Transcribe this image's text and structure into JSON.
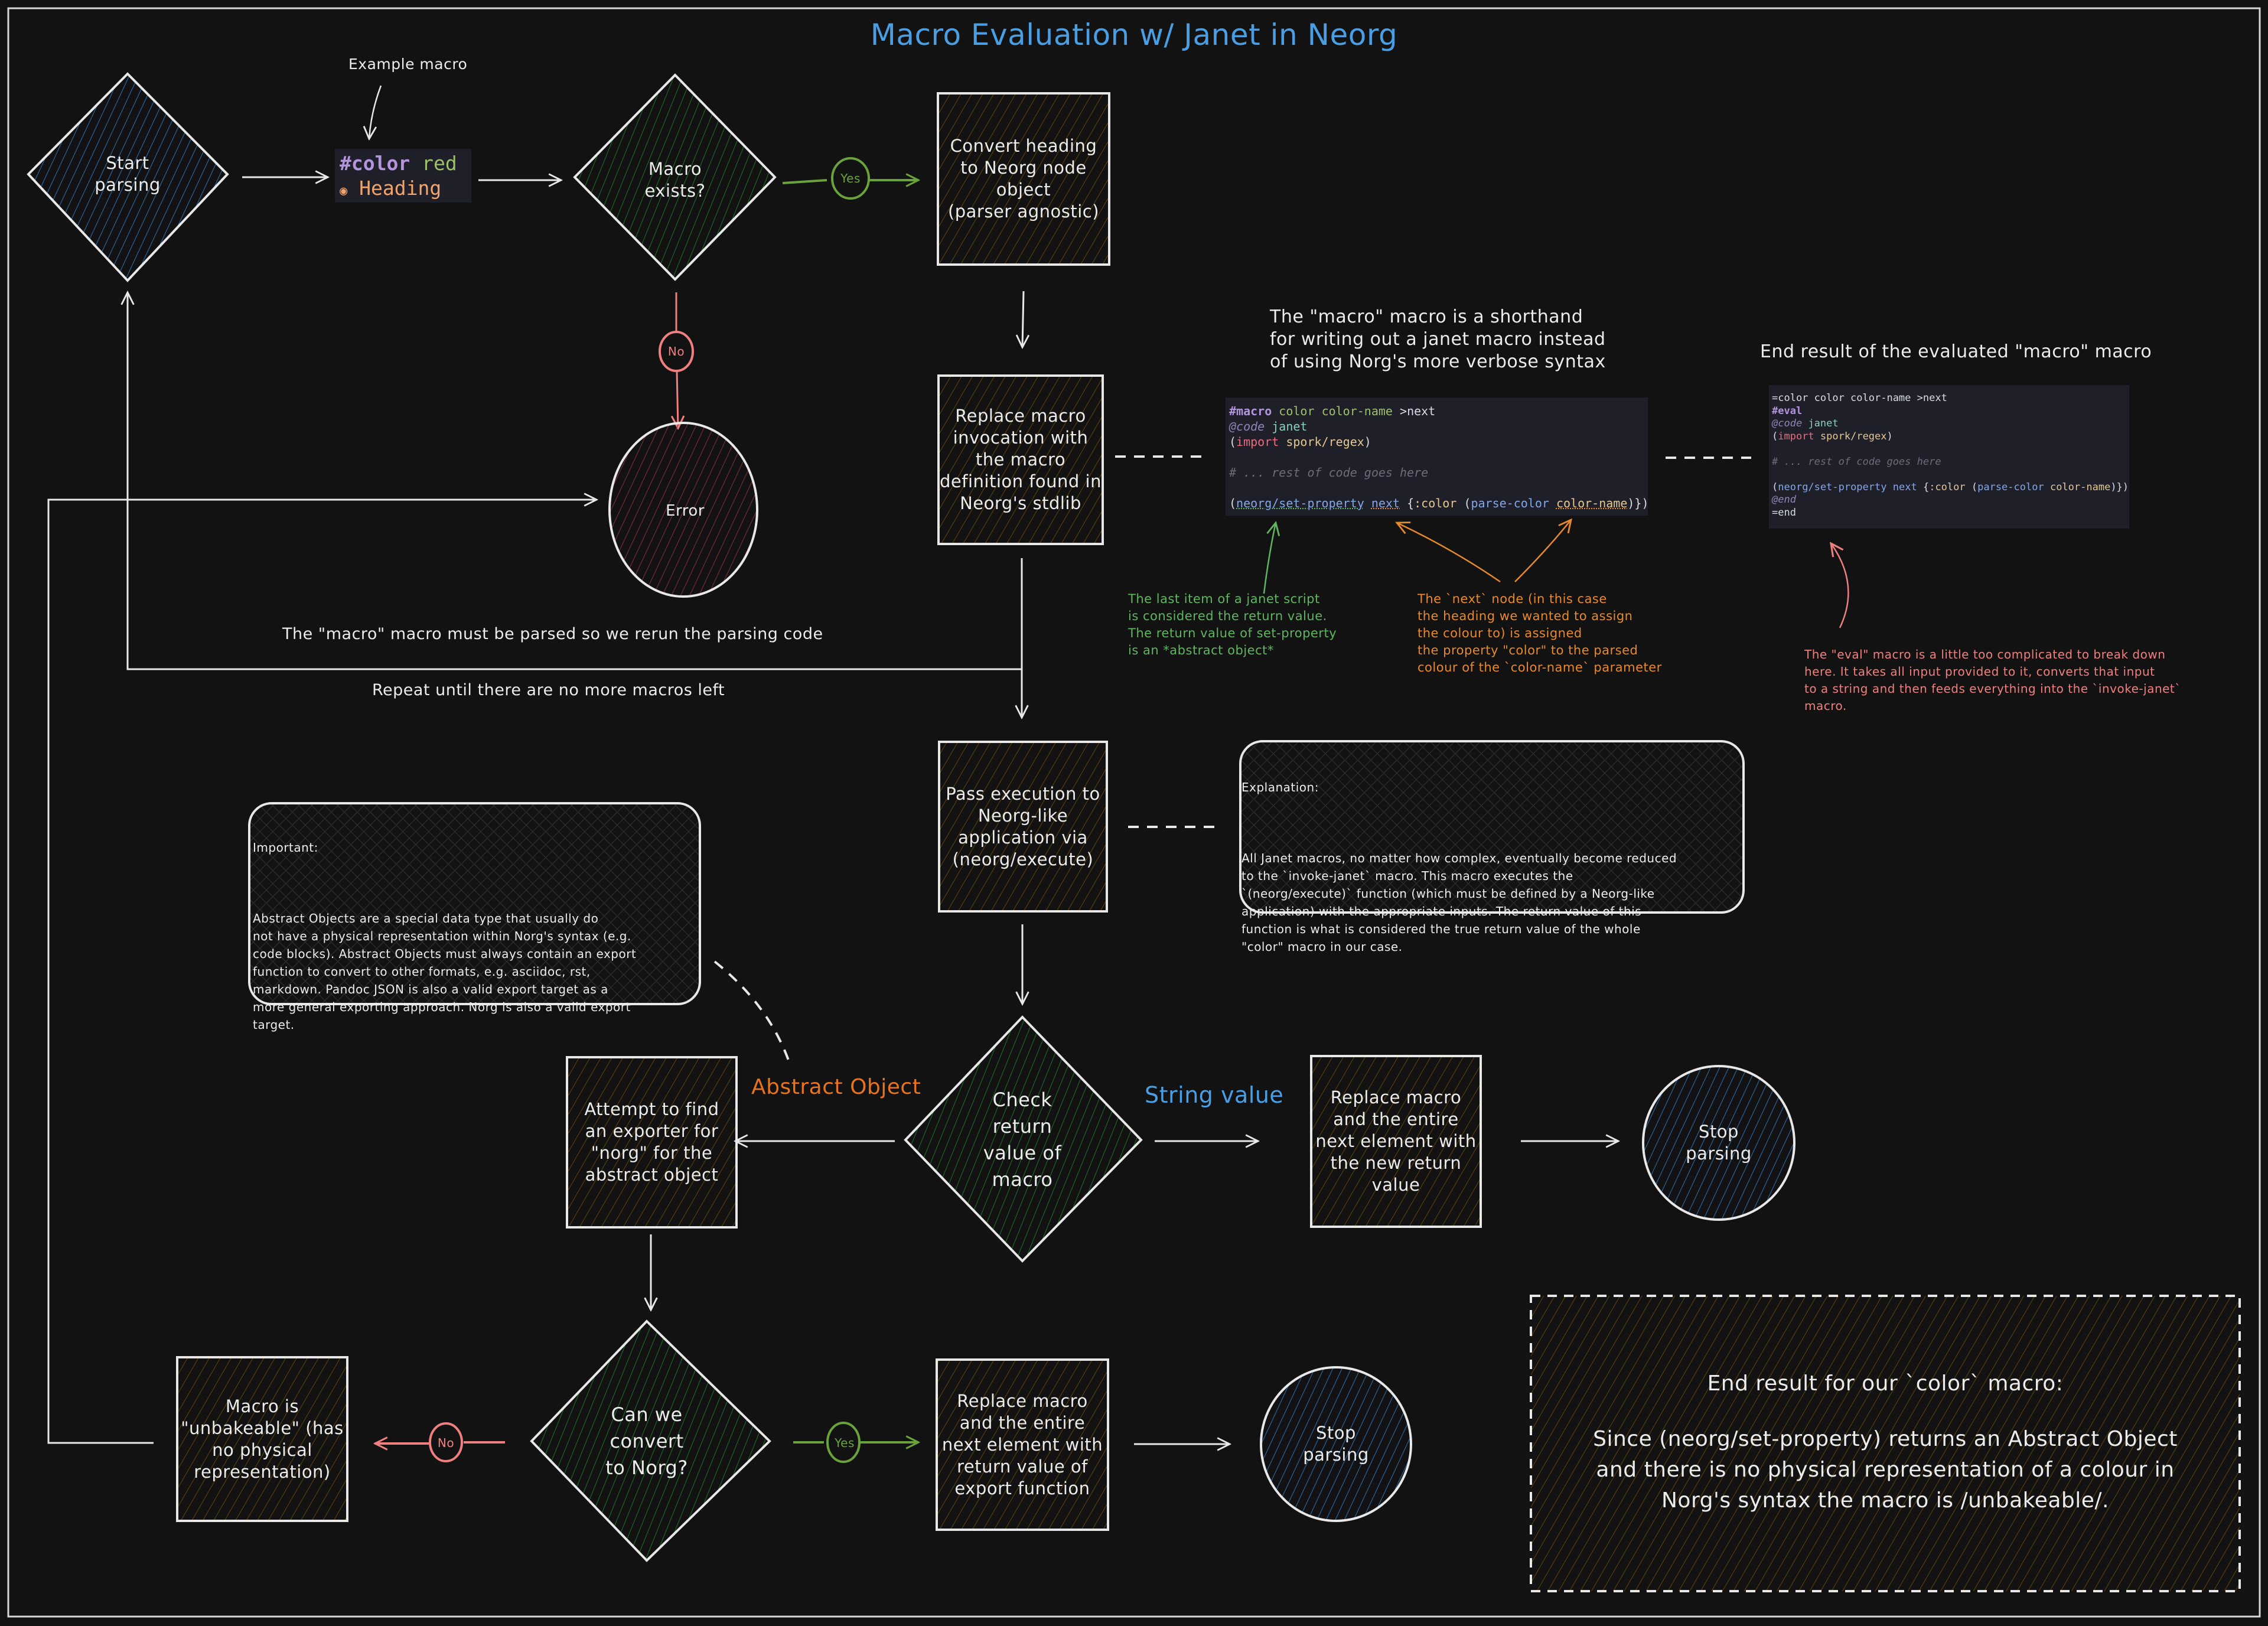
{
  "title": "Macro Evaluation w/ Janet in Neorg",
  "colors": {
    "background": "#121212",
    "stroke": "#e8e8e8",
    "title_blue": "#4a9fe4",
    "yes_green": "#6aa33a",
    "no_red": "#f07f7f",
    "green_note": "#5fb65f",
    "orange_note": "#e8892a",
    "red_note": "#f07f7f",
    "abstract_orange": "#e8731f",
    "string_blue": "#4a9fe4",
    "fill_blue": "#1f4e7a",
    "fill_green": "#1b5e2a",
    "fill_brown": "#5a3f0e",
    "fill_red": "#7a2f36"
  },
  "annotations": {
    "example_macro": "Example macro",
    "rerun_parsing": "The \"macro\" macro must be parsed so we rerun the parsing code",
    "repeat_until": "Repeat until there are no more macros left",
    "macro_shorthand": "The \"macro\" macro is a shorthand\nfor writing out a janet macro instead\nof using Norg's more verbose syntax",
    "end_result_heading": "End result of the evaluated \"macro\" macro",
    "last_item_note": "The last item of a janet script\nis considered the return value.\nThe return value of set-property\nis an *abstract object*",
    "next_node_note": "The `next` node (in this case\nthe heading we wanted to assign\nthe colour to) is assigned\nthe property \"color\" to the parsed\ncolour of the `color-name` parameter",
    "eval_note": "The \"eval\" macro is a little too complicated to break down\nhere. It takes all input provided to it, converts that input\nto a string and then feeds everything into the `invoke-janet`\nmacro.",
    "abstract_object_label": "Abstract Object",
    "string_value_label": "String value"
  },
  "example_snippet": {
    "line1_keyword": "#color",
    "line1_arg": "red",
    "line2_bullet": "◉",
    "line2_text": "Heading"
  },
  "nodes": {
    "start_parsing": "Start\nparsing",
    "macro_exists": "Macro\nexists?",
    "convert_heading": "Convert heading\nto Neorg node\nobject\n(parser agnostic)",
    "replace_invocation": "Replace macro\ninvocation with\nthe macro\ndefinition found in\nNeorg's stdlib",
    "error": "Error",
    "pass_execution": "Pass execution to\nNeorg-like\napplication via\n(neorg/execute)",
    "check_return": "Check\nreturn\nvalue of\nmacro",
    "attempt_exporter": "Attempt to find\nan exporter for\n\"norg\" for the\nabstract object",
    "replace_string": "Replace macro\nand the entire\nnext element with\nthe new return\nvalue",
    "stop_parsing_1": "Stop\nparsing",
    "can_convert": "Can we\nconvert\nto Norg?",
    "unbakeable": "Macro is\n\"unbakeable\" (has\nno physical\nrepresentation)",
    "replace_export": "Replace macro\nand the entire\nnext element with\nreturn value of\nexport function",
    "stop_parsing_2": "Stop\nparsing"
  },
  "edge_labels": {
    "yes_1": "Yes",
    "no_1": "No",
    "no_2": "No",
    "yes_2": "Yes"
  },
  "code_macro": {
    "l1_kw": "#macro",
    "l1_a": "color",
    "l1_b": "color-name",
    "l1_c": ">next",
    "l2_at": "@code",
    "l2_lang": "janet",
    "l3_open": "(",
    "l3_kw": "import",
    "l3_mod": "spork/regex",
    "l3_close": ")",
    "l4_comment": "# ... rest of code goes here",
    "l5_open": "(",
    "l5_fn": "neorg/set-property",
    "l5_next": "next",
    "l5_brace": "{",
    "l5_key": ":color",
    "l5_paren": "(",
    "l5_fn2": "parse-color",
    "l5_arg": "color-name",
    "l5_close": ")})"
  },
  "code_result": {
    "l1": "=color color color-name >next",
    "l2_kw": "#eval",
    "l3_at": "@code",
    "l3_lang": "janet",
    "l4_open": "(",
    "l4_kw": "import",
    "l4_mod": "spork/regex",
    "l4_close": ")",
    "l5_comment": "# ... rest of code goes here",
    "l6_open": "(",
    "l6_fn": "neorg/set-property",
    "l6_next": "next",
    "l6_brace": "{",
    "l6_key": ":color",
    "l6_paren": "(",
    "l6_fn2": "parse-color",
    "l6_arg": "color-name",
    "l6_close": ")})",
    "l7_at": "@end",
    "l8": "=end"
  },
  "notes": {
    "important_title": "Important:",
    "important_body": "Abstract Objects are a special data type that usually do\nnot have a physical representation within Norg's syntax (e.g.\ncode blocks). Abstract Objects must always contain an export\nfunction to convert to other formats, e.g. asciidoc, rst,\nmarkdown. Pandoc JSON is also a valid export target as a\nmore general exporting approach. Norg is also a valid export\ntarget.",
    "explanation_title": "Explanation:",
    "explanation_body": "All Janet macros, no matter how complex, eventually become reduced\nto the `invoke-janet` macro. This macro executes the\n`(neorg/execute)` function (which must be defined by a Neorg-like\napplication) with the appropriate inputs. The return value of this\nfunction is what is considered the true return value of the whole\n\"color\" macro in our case.",
    "end_result_title": "End result for our `color` macro:",
    "end_result_body": "Since (neorg/set-property) returns an Abstract Object\nand there is no physical representation of a colour in\nNorg's syntax the macro is /unbakeable/."
  }
}
